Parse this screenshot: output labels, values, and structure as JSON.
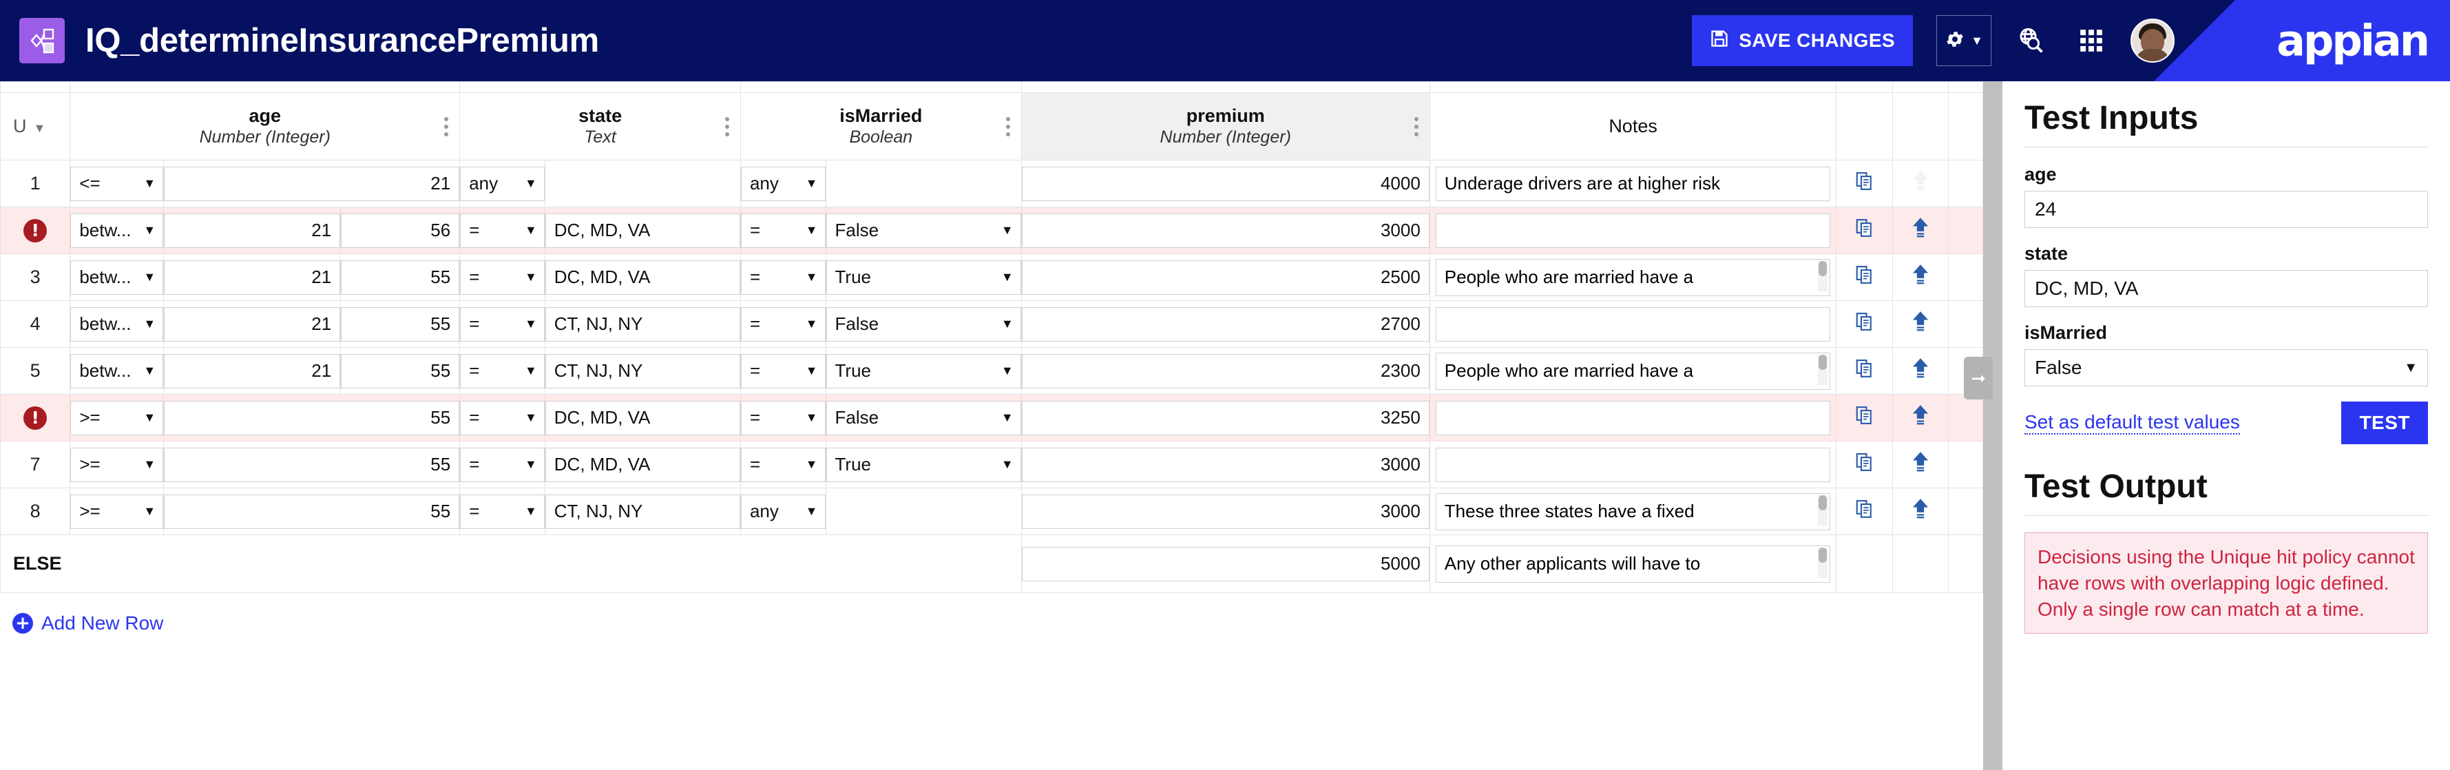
{
  "header": {
    "app_title": "IQ_determineInsurancePremium",
    "app_icon": "decision-node-icon",
    "save_label": "SAVE CHANGES",
    "save_icon": "save-disk-icon",
    "gear_icon": "gear-icon",
    "chevron_icon": "▼",
    "search_icon": "globe-search-icon",
    "apps_icon": "grid-apps-icon",
    "avatar_icon": "user-avatar",
    "brand": "appian",
    "brand_color": "#2b35f0",
    "bar_color": "#051061"
  },
  "table": {
    "hit_policy_label": "U",
    "hit_policy_caret": "▼",
    "columns": [
      {
        "name": "age",
        "type": "Number (Integer)"
      },
      {
        "name": "state",
        "type": "Text"
      },
      {
        "name": "isMarried",
        "type": "Boolean"
      },
      {
        "name": "premium",
        "type": "Number (Integer)"
      }
    ],
    "notes_header": "Notes",
    "copy_icon": "copy-row-icon",
    "move_up_icon": "move-row-up-icon",
    "kebab_icon": "column-menu-icon",
    "else_label": "ELSE",
    "add_row_label": "Add New Row",
    "add_row_icon": "plus-circle-icon",
    "error_icon": "error-exclamation-icon",
    "rows": [
      {
        "num": "1",
        "error": false,
        "age_op": "<=",
        "age_v1": "21",
        "age_v2": "",
        "state_op": "any",
        "state_val": "",
        "married_op": "any",
        "married_val": "",
        "premium": "4000",
        "notes": "Underage drivers are at higher risk",
        "notes_scroll": false,
        "move_up_enabled": false
      },
      {
        "num": "",
        "error": true,
        "age_op": "betw...",
        "age_v1": "21",
        "age_v2": "56",
        "state_op": "=",
        "state_val": "DC, MD, VA",
        "married_op": "=",
        "married_val": "False",
        "premium": "3000",
        "notes": "",
        "notes_scroll": false,
        "move_up_enabled": true
      },
      {
        "num": "3",
        "error": false,
        "age_op": "betw...",
        "age_v1": "21",
        "age_v2": "55",
        "state_op": "=",
        "state_val": "DC, MD, VA",
        "married_op": "=",
        "married_val": "True",
        "premium": "2500",
        "notes": "People who are married have a",
        "notes_scroll": true,
        "move_up_enabled": true
      },
      {
        "num": "4",
        "error": false,
        "age_op": "betw...",
        "age_v1": "21",
        "age_v2": "55",
        "state_op": "=",
        "state_val": "CT, NJ, NY",
        "married_op": "=",
        "married_val": "False",
        "premium": "2700",
        "notes": "",
        "notes_scroll": false,
        "move_up_enabled": true
      },
      {
        "num": "5",
        "error": false,
        "age_op": "betw...",
        "age_v1": "21",
        "age_v2": "55",
        "state_op": "=",
        "state_val": "CT, NJ, NY",
        "married_op": "=",
        "married_val": "True",
        "premium": "2300",
        "notes": "People who are married have a",
        "notes_scroll": true,
        "move_up_enabled": true
      },
      {
        "num": "",
        "error": true,
        "age_op": ">=",
        "age_v1": "55",
        "age_v2": "",
        "state_op": "=",
        "state_val": "DC, MD, VA",
        "married_op": "=",
        "married_val": "False",
        "premium": "3250",
        "notes": "",
        "notes_scroll": false,
        "move_up_enabled": true
      },
      {
        "num": "7",
        "error": false,
        "age_op": ">=",
        "age_v1": "55",
        "age_v2": "",
        "state_op": "=",
        "state_val": "DC, MD, VA",
        "married_op": "=",
        "married_val": "True",
        "premium": "3000",
        "notes": "",
        "notes_scroll": false,
        "move_up_enabled": true
      },
      {
        "num": "8",
        "error": false,
        "age_op": ">=",
        "age_v1": "55",
        "age_v2": "",
        "state_op": "=",
        "state_val": "CT, NJ, NY",
        "married_op": "any",
        "married_val": "",
        "premium": "3000",
        "notes": "These three states have a fixed",
        "notes_scroll": true,
        "move_up_enabled": true
      }
    ],
    "else_row": {
      "premium": "5000",
      "notes": "Any other applicants will have to",
      "notes_scroll": true
    },
    "scroll_right_icon": "scroll-right-arrow-icon"
  },
  "test_panel": {
    "inputs_title": "Test Inputs",
    "age_label": "age",
    "age_value": "24",
    "state_label": "state",
    "state_value": "DC, MD, VA",
    "married_label": "isMarried",
    "married_value": "False",
    "married_caret": "▼",
    "set_default_label": "Set as default test values",
    "test_button": "TEST",
    "output_title": "Test Output",
    "output_error": "Decisions using the Unique hit policy cannot have rows with overlapping logic defined. Only a single row can match at a time.",
    "error_color": "#cf2340"
  }
}
